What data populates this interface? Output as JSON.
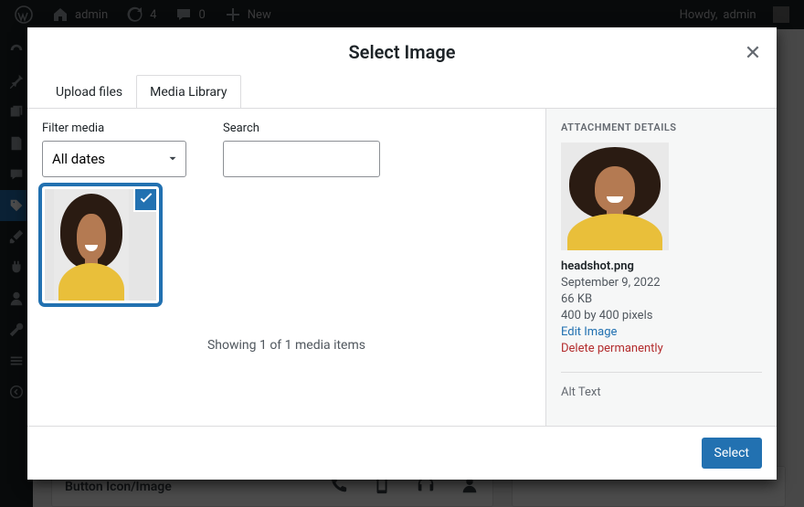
{
  "adminbar": {
    "site_name": "admin",
    "updates_count": "4",
    "comments_count": "0",
    "new_label": "New",
    "howdy_prefix": "Howdy, ",
    "user_name": "admin"
  },
  "page_behind": {
    "panel_label": "Button Icon/Image"
  },
  "modal": {
    "title": "Select Image",
    "tabs": {
      "upload": "Upload files",
      "library": "Media Library"
    },
    "filter_label": "Filter media",
    "date_filter_value": "All dates",
    "search_label": "Search",
    "search_value": "",
    "items_count_text": "Showing 1 of 1 media items",
    "details_heading": "ATTACHMENT DETAILS",
    "attachment": {
      "filename": "headshot.png",
      "date": "September 9, 2022",
      "filesize": "66 KB",
      "dimensions": "400 by 400 pixels",
      "edit_label": "Edit Image",
      "delete_label": "Delete permanently",
      "alt_label": "Alt Text"
    },
    "select_button": "Select"
  }
}
